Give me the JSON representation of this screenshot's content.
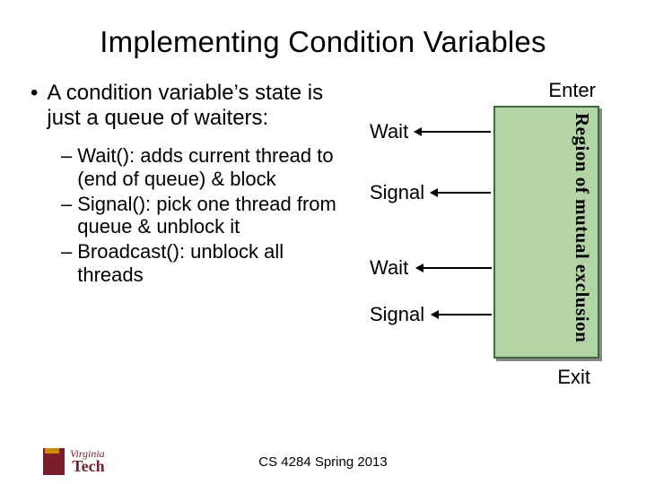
{
  "title": "Implementing Condition Variables",
  "main_bullet": "A condition variable’s state is just a queue of waiters:",
  "sub_items": [
    "Wait(): adds current thread to (end of queue) & block",
    "Signal(): pick one thread from queue & unblock it",
    "Broadcast(): unblock all threads"
  ],
  "diagram": {
    "enter": "Enter",
    "exit": "Exit",
    "region_label": "Region of mutual exclusion",
    "events": {
      "wait1": "Wait",
      "signal1": "Signal",
      "wait2": "Wait",
      "signal2": "Signal"
    }
  },
  "footer": "CS 4284 Spring 2013",
  "logo": {
    "inst": "Virginia",
    "tech": "Tech"
  }
}
